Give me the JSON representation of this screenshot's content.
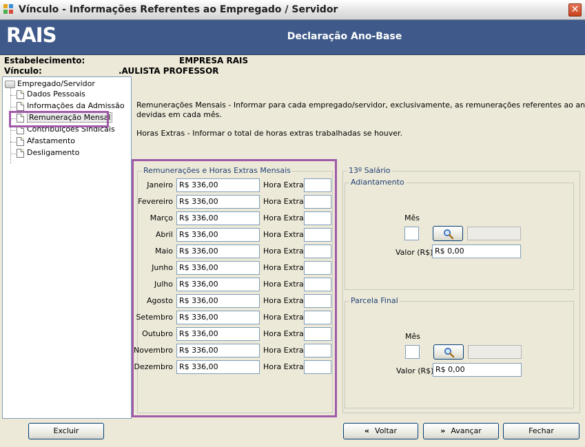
{
  "window": {
    "title": "Vínculo - Informações Referentes ao Empregado / Servidor"
  },
  "banner": {
    "logo": "RAIS",
    "title": "Declaração Ano-Base"
  },
  "info": {
    "estabelecimento_label": "Estabelecimento:",
    "estabelecimento_value": "EMPRESA RAIS",
    "vinculo_label": "Vínculo:",
    "vinculo_value": ".AULISTA PROFESSOR"
  },
  "tree": {
    "root": "Empregado/Servidor",
    "items": [
      {
        "label": "Dados Pessoais"
      },
      {
        "label": "Informações da Admissão"
      },
      {
        "label": "Remuneração Mensal",
        "selected": true
      },
      {
        "label": "Contribuições Sindicais"
      },
      {
        "label": "Afastamento"
      },
      {
        "label": "Desligamento"
      }
    ]
  },
  "description": {
    "line1": "Remunerações Mensais - Informar para cada empregado/servidor, exclusivamente, as remunerações referentes ao ano-base,",
    "line2": "devidas em cada mês.",
    "line3": "Horas Extras - Informar o total de horas extras trabalhadas se houver."
  },
  "monthly": {
    "group_title": "Remunerações e Horas Extras Mensais",
    "hora_label": "Hora Extra",
    "rows": [
      {
        "month": "Janeiro",
        "value": "R$ 336,00",
        "hora": ""
      },
      {
        "month": "Fevereiro",
        "value": "R$ 336,00",
        "hora": ""
      },
      {
        "month": "Março",
        "value": "R$ 336,00",
        "hora": ""
      },
      {
        "month": "Abril",
        "value": "R$ 336,00",
        "hora": ""
      },
      {
        "month": "Maio",
        "value": "R$ 336,00",
        "hora": ""
      },
      {
        "month": "Junho",
        "value": "R$ 336,00",
        "hora": ""
      },
      {
        "month": "Julho",
        "value": "R$ 336,00",
        "hora": ""
      },
      {
        "month": "Agosto",
        "value": "R$ 336,00",
        "hora": ""
      },
      {
        "month": "Setembro",
        "value": "R$ 336,00",
        "hora": ""
      },
      {
        "month": "Outubro",
        "value": "R$ 336,00",
        "hora": ""
      },
      {
        "month": "Novembro",
        "value": "R$ 336,00",
        "hora": ""
      },
      {
        "month": "Dezembro",
        "value": "R$ 336,00",
        "hora": ""
      }
    ]
  },
  "decimo": {
    "group_title": "13º Salário",
    "adiantamento": {
      "title": "Adiantamento",
      "mes_label": "Mês",
      "mes_value": "",
      "valor_label": "Valor (R$)",
      "valor_value": "R$ 0,00"
    },
    "parcela_final": {
      "title": "Parcela Final",
      "mes_label": "Mês",
      "mes_value": "",
      "valor_label": "Valor (R$)",
      "valor_value": "R$ 0,00"
    }
  },
  "buttons": {
    "excluir": "Excluir",
    "voltar": "Voltar",
    "avancar": "Avançar",
    "fechar": "Fechar"
  },
  "colors": {
    "banner": "#3f5a8a",
    "highlight": "#a05aa8",
    "close": "#c8421c"
  }
}
